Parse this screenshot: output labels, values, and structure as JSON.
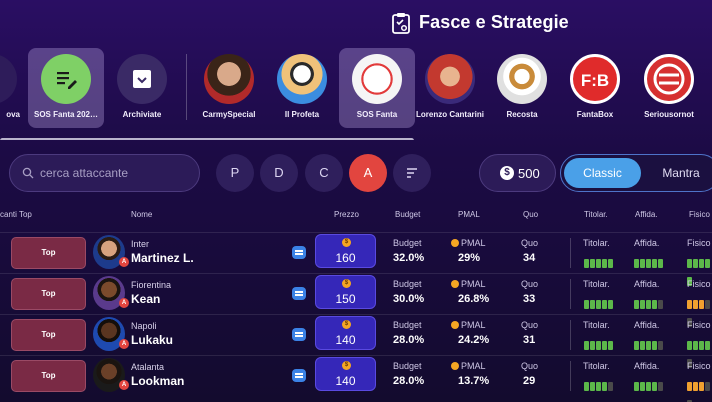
{
  "header": {
    "title": "Fasce e Strategie",
    "icon": "clipboard-strategy-icon"
  },
  "sources": [
    {
      "id": "nuova",
      "label": "ova",
      "selected": false
    },
    {
      "id": "sos-fanta-2024",
      "label": "SOS Fanta 202…",
      "selected": true,
      "color": "#7fd066"
    },
    {
      "id": "archiviate",
      "label": "Archiviate",
      "selected": false
    },
    {
      "id": "carmy",
      "label": "CarmySpecial",
      "selected": false
    },
    {
      "id": "profeta",
      "label": "Il Profeta",
      "selected": false
    },
    {
      "id": "sosfanta",
      "label": "SOS Fanta",
      "selected": true
    },
    {
      "id": "cantarini",
      "label": "Lorenzo Cantarini",
      "selected": false
    },
    {
      "id": "recosta",
      "label": "Recosta",
      "selected": false
    },
    {
      "id": "fantabox",
      "label": "FantaBox",
      "selected": false
    },
    {
      "id": "seriousornot",
      "label": "Seriousornot",
      "selected": false
    }
  ],
  "search": {
    "placeholder": "cerca attaccante",
    "value": ""
  },
  "roles": [
    {
      "label": "P",
      "active": false
    },
    {
      "label": "D",
      "active": false
    },
    {
      "label": "C",
      "active": false
    },
    {
      "label": "A",
      "active": true
    }
  ],
  "budget": {
    "symbol": "$",
    "value": "500"
  },
  "mode": {
    "options": [
      "Classic",
      "Mantra"
    ],
    "selected": "Classic"
  },
  "columns": {
    "fascia": "canti Top",
    "nome": "Nome",
    "prezzo": "Prezzo",
    "budget": "Budget",
    "pmal": "PMAL",
    "quo": "Quo",
    "titolar": "Titolar.",
    "affida": "Affida.",
    "fisico": "Fisico"
  },
  "rows": [
    {
      "tag": "Top",
      "team": "Inter",
      "name": "Martinez L.",
      "price": "160",
      "budget_label": "Budget",
      "budget": "32.0%",
      "pmal_label": "PMAL",
      "pmal": "29%",
      "quo_label": "Quo",
      "quo": "34",
      "titolar_label": "Titolar.",
      "affida_label": "Affida.",
      "fisico_label": "Fisico",
      "titolar": 5,
      "affida": 5,
      "fisico": 5,
      "fisico_color": "green"
    },
    {
      "tag": "Top",
      "team": "Fiorentina",
      "name": "Kean",
      "price": "150",
      "budget_label": "Budget",
      "budget": "30.0%",
      "pmal_label": "PMAL",
      "pmal": "26.8%",
      "quo_label": "Quo",
      "quo": "33",
      "titolar_label": "Titolar.",
      "affida_label": "Affida.",
      "fisico_label": "Fisico",
      "titolar": 5,
      "affida": 4,
      "fisico": 3,
      "fisico_color": "orange"
    },
    {
      "tag": "Top",
      "team": "Napoli",
      "name": "Lukaku",
      "price": "140",
      "budget_label": "Budget",
      "budget": "28.0%",
      "pmal_label": "PMAL",
      "pmal": "24.2%",
      "quo_label": "Quo",
      "quo": "31",
      "titolar_label": "Titolar.",
      "affida_label": "Affida.",
      "fisico_label": "Fisico",
      "titolar": 5,
      "affida": 4,
      "fisico": 4,
      "fisico_color": "green"
    },
    {
      "tag": "Top",
      "team": "Atalanta",
      "name": "Lookman",
      "price": "140",
      "budget_label": "Budget",
      "budget": "28.0%",
      "pmal_label": "PMAL",
      "pmal": "13.7%",
      "quo_label": "Quo",
      "quo": "29",
      "titolar_label": "Titolar.",
      "affida_label": "Affida.",
      "fisico_label": "Fisico",
      "titolar": 4,
      "affida": 4,
      "fisico": 3,
      "fisico_color": "orange"
    }
  ],
  "colors": {
    "accent": "#4aa0e8",
    "active_role": "#e2453f",
    "tag_top": "#7a2a45",
    "price": "#3527b8"
  }
}
